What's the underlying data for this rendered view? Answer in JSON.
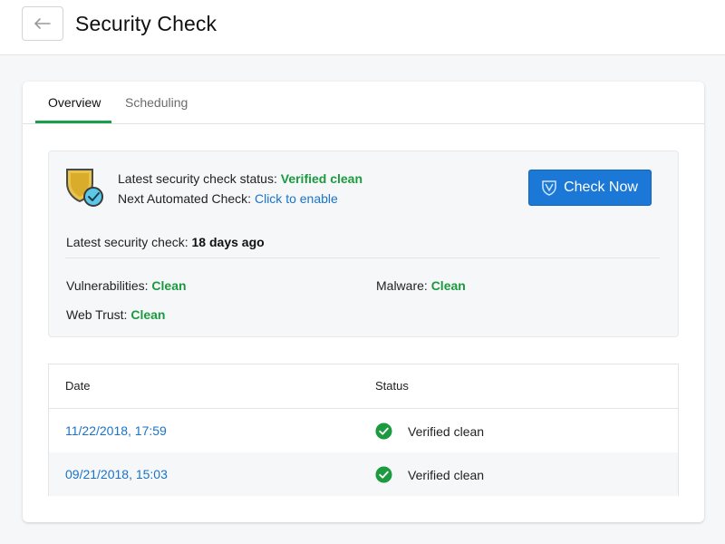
{
  "header": {
    "title": "Security Check",
    "back_icon": "arrow-left-icon"
  },
  "tabs": [
    {
      "label": "Overview",
      "active": true
    },
    {
      "label": "Scheduling",
      "active": false
    }
  ],
  "status": {
    "shield_icon": "shield-check-icon",
    "latest_status_label": "Latest security check status:",
    "latest_status_value": "Verified clean",
    "next_check_label": "Next Automated Check:",
    "next_check_link": "Click to enable",
    "check_button_label": "Check Now",
    "last_check_label": "Latest security check:",
    "last_check_value": "18 days ago",
    "vulnerabilities_label": "Vulnerabilities:",
    "vulnerabilities_value": "Clean",
    "malware_label": "Malware:",
    "malware_value": "Clean",
    "webtrust_label": "Web Trust:",
    "webtrust_value": "Clean"
  },
  "history": {
    "columns": [
      "Date",
      "Status"
    ],
    "rows": [
      {
        "date": "11/22/2018, 17:59",
        "status": "Verified clean"
      },
      {
        "date": "09/21/2018, 15:03",
        "status": "Verified clean"
      }
    ]
  },
  "colors": {
    "accent_green": "#1b9a3f",
    "link_blue": "#1a73c8",
    "button_blue": "#1b78d6"
  }
}
